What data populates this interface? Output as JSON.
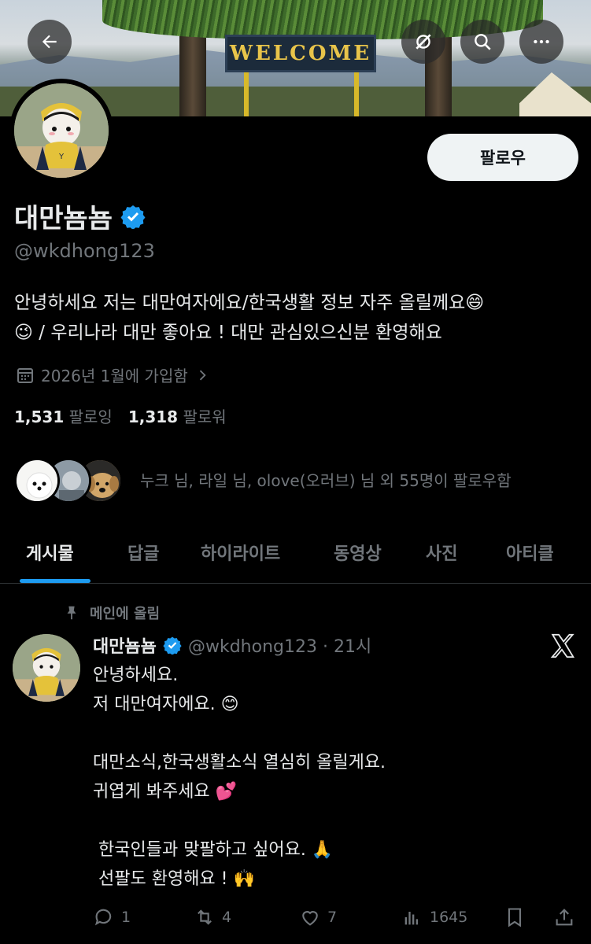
{
  "banner": {
    "sign_text": "WELCOME"
  },
  "topbar": {
    "back_icon": "arrow-left-icon",
    "grok_icon": "grok-icon",
    "search_icon": "search-icon",
    "more_icon": "more-icon"
  },
  "profile": {
    "follow_label": "팔로우",
    "display_name": "대만뇸뇸",
    "handle": "@wkdhong123",
    "bio_line1": "안녕하세요 저는 대만여자에요/한국생활 정보 자주 올릴께요😄",
    "bio_line2": "😉 / 우리나라 대만 좋아요 ! 대만 관심있으신분 환영해요",
    "joined": "2026년 1월에 가입함",
    "following_count": "1,531",
    "following_label": "팔로잉",
    "followers_count": "1,318",
    "followers_label": "팔로워",
    "followed_by": "누크 님, 라일 님, olove(오러브) 님 외 55명이 팔로우함"
  },
  "tabs": [
    {
      "label": "게시물"
    },
    {
      "label": "답글"
    },
    {
      "label": "하이라이트"
    },
    {
      "label": "동영상"
    },
    {
      "label": "사진"
    },
    {
      "label": "아티클"
    }
  ],
  "post": {
    "pinned_label": "메인에 올림",
    "author": "대만뇸뇸",
    "handle_time": "@wkdhong123 · 21시",
    "body": "안녕하세요.\n저 대만여자에요. 😊\n\n대만소식,한국생활소식 열심히 올릴게요.\n귀엽게 봐주세요 💕\n\n 한국인들과 맞팔하고 싶어요. 🙏\n 선팔도 환영해요 ! 🙌",
    "replies": "1",
    "reposts": "4",
    "likes": "7",
    "views": "1645"
  },
  "colors": {
    "accent": "#1d9bf0",
    "muted": "#71767b",
    "text": "#e7e9ea",
    "background": "#000000"
  }
}
